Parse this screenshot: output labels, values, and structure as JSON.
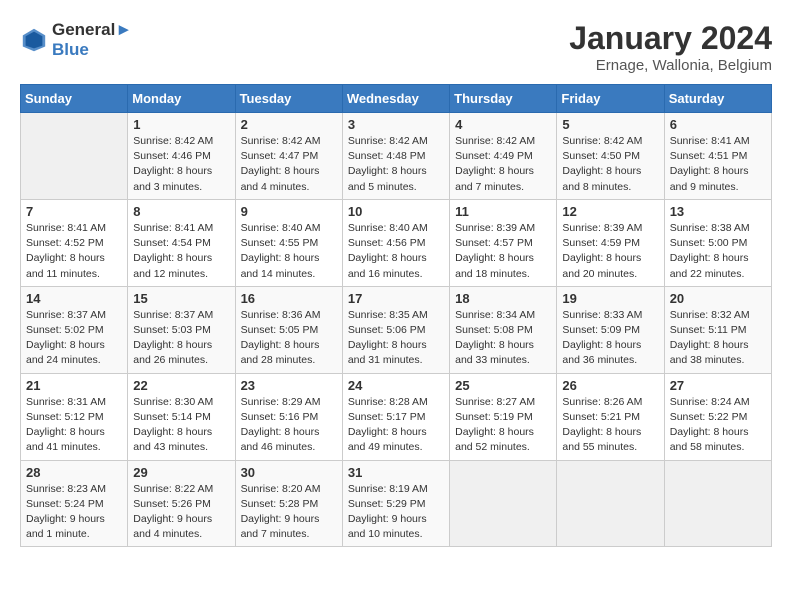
{
  "header": {
    "logo_line1": "General",
    "logo_line2": "Blue",
    "month": "January 2024",
    "location": "Ernage, Wallonia, Belgium"
  },
  "weekdays": [
    "Sunday",
    "Monday",
    "Tuesday",
    "Wednesday",
    "Thursday",
    "Friday",
    "Saturday"
  ],
  "weeks": [
    [
      {
        "day": "",
        "sunrise": "",
        "sunset": "",
        "daylight": ""
      },
      {
        "day": "1",
        "sunrise": "Sunrise: 8:42 AM",
        "sunset": "Sunset: 4:46 PM",
        "daylight": "Daylight: 8 hours and 3 minutes."
      },
      {
        "day": "2",
        "sunrise": "Sunrise: 8:42 AM",
        "sunset": "Sunset: 4:47 PM",
        "daylight": "Daylight: 8 hours and 4 minutes."
      },
      {
        "day": "3",
        "sunrise": "Sunrise: 8:42 AM",
        "sunset": "Sunset: 4:48 PM",
        "daylight": "Daylight: 8 hours and 5 minutes."
      },
      {
        "day": "4",
        "sunrise": "Sunrise: 8:42 AM",
        "sunset": "Sunset: 4:49 PM",
        "daylight": "Daylight: 8 hours and 7 minutes."
      },
      {
        "day": "5",
        "sunrise": "Sunrise: 8:42 AM",
        "sunset": "Sunset: 4:50 PM",
        "daylight": "Daylight: 8 hours and 8 minutes."
      },
      {
        "day": "6",
        "sunrise": "Sunrise: 8:41 AM",
        "sunset": "Sunset: 4:51 PM",
        "daylight": "Daylight: 8 hours and 9 minutes."
      }
    ],
    [
      {
        "day": "7",
        "sunrise": "Sunrise: 8:41 AM",
        "sunset": "Sunset: 4:52 PM",
        "daylight": "Daylight: 8 hours and 11 minutes."
      },
      {
        "day": "8",
        "sunrise": "Sunrise: 8:41 AM",
        "sunset": "Sunset: 4:54 PM",
        "daylight": "Daylight: 8 hours and 12 minutes."
      },
      {
        "day": "9",
        "sunrise": "Sunrise: 8:40 AM",
        "sunset": "Sunset: 4:55 PM",
        "daylight": "Daylight: 8 hours and 14 minutes."
      },
      {
        "day": "10",
        "sunrise": "Sunrise: 8:40 AM",
        "sunset": "Sunset: 4:56 PM",
        "daylight": "Daylight: 8 hours and 16 minutes."
      },
      {
        "day": "11",
        "sunrise": "Sunrise: 8:39 AM",
        "sunset": "Sunset: 4:57 PM",
        "daylight": "Daylight: 8 hours and 18 minutes."
      },
      {
        "day": "12",
        "sunrise": "Sunrise: 8:39 AM",
        "sunset": "Sunset: 4:59 PM",
        "daylight": "Daylight: 8 hours and 20 minutes."
      },
      {
        "day": "13",
        "sunrise": "Sunrise: 8:38 AM",
        "sunset": "Sunset: 5:00 PM",
        "daylight": "Daylight: 8 hours and 22 minutes."
      }
    ],
    [
      {
        "day": "14",
        "sunrise": "Sunrise: 8:37 AM",
        "sunset": "Sunset: 5:02 PM",
        "daylight": "Daylight: 8 hours and 24 minutes."
      },
      {
        "day": "15",
        "sunrise": "Sunrise: 8:37 AM",
        "sunset": "Sunset: 5:03 PM",
        "daylight": "Daylight: 8 hours and 26 minutes."
      },
      {
        "day": "16",
        "sunrise": "Sunrise: 8:36 AM",
        "sunset": "Sunset: 5:05 PM",
        "daylight": "Daylight: 8 hours and 28 minutes."
      },
      {
        "day": "17",
        "sunrise": "Sunrise: 8:35 AM",
        "sunset": "Sunset: 5:06 PM",
        "daylight": "Daylight: 8 hours and 31 minutes."
      },
      {
        "day": "18",
        "sunrise": "Sunrise: 8:34 AM",
        "sunset": "Sunset: 5:08 PM",
        "daylight": "Daylight: 8 hours and 33 minutes."
      },
      {
        "day": "19",
        "sunrise": "Sunrise: 8:33 AM",
        "sunset": "Sunset: 5:09 PM",
        "daylight": "Daylight: 8 hours and 36 minutes."
      },
      {
        "day": "20",
        "sunrise": "Sunrise: 8:32 AM",
        "sunset": "Sunset: 5:11 PM",
        "daylight": "Daylight: 8 hours and 38 minutes."
      }
    ],
    [
      {
        "day": "21",
        "sunrise": "Sunrise: 8:31 AM",
        "sunset": "Sunset: 5:12 PM",
        "daylight": "Daylight: 8 hours and 41 minutes."
      },
      {
        "day": "22",
        "sunrise": "Sunrise: 8:30 AM",
        "sunset": "Sunset: 5:14 PM",
        "daylight": "Daylight: 8 hours and 43 minutes."
      },
      {
        "day": "23",
        "sunrise": "Sunrise: 8:29 AM",
        "sunset": "Sunset: 5:16 PM",
        "daylight": "Daylight: 8 hours and 46 minutes."
      },
      {
        "day": "24",
        "sunrise": "Sunrise: 8:28 AM",
        "sunset": "Sunset: 5:17 PM",
        "daylight": "Daylight: 8 hours and 49 minutes."
      },
      {
        "day": "25",
        "sunrise": "Sunrise: 8:27 AM",
        "sunset": "Sunset: 5:19 PM",
        "daylight": "Daylight: 8 hours and 52 minutes."
      },
      {
        "day": "26",
        "sunrise": "Sunrise: 8:26 AM",
        "sunset": "Sunset: 5:21 PM",
        "daylight": "Daylight: 8 hours and 55 minutes."
      },
      {
        "day": "27",
        "sunrise": "Sunrise: 8:24 AM",
        "sunset": "Sunset: 5:22 PM",
        "daylight": "Daylight: 8 hours and 58 minutes."
      }
    ],
    [
      {
        "day": "28",
        "sunrise": "Sunrise: 8:23 AM",
        "sunset": "Sunset: 5:24 PM",
        "daylight": "Daylight: 9 hours and 1 minute."
      },
      {
        "day": "29",
        "sunrise": "Sunrise: 8:22 AM",
        "sunset": "Sunset: 5:26 PM",
        "daylight": "Daylight: 9 hours and 4 minutes."
      },
      {
        "day": "30",
        "sunrise": "Sunrise: 8:20 AM",
        "sunset": "Sunset: 5:28 PM",
        "daylight": "Daylight: 9 hours and 7 minutes."
      },
      {
        "day": "31",
        "sunrise": "Sunrise: 8:19 AM",
        "sunset": "Sunset: 5:29 PM",
        "daylight": "Daylight: 9 hours and 10 minutes."
      },
      {
        "day": "",
        "sunrise": "",
        "sunset": "",
        "daylight": ""
      },
      {
        "day": "",
        "sunrise": "",
        "sunset": "",
        "daylight": ""
      },
      {
        "day": "",
        "sunrise": "",
        "sunset": "",
        "daylight": ""
      }
    ]
  ]
}
